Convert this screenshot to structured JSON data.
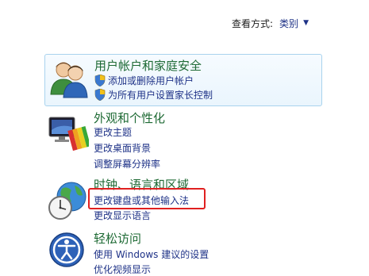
{
  "view": {
    "label": "查看方式:",
    "value": "类别"
  },
  "categories": [
    {
      "title": "用户帐户和家庭安全",
      "icon": "users-icon",
      "links": [
        "添加或删除用户帐户",
        "为所有用户设置家长控制"
      ]
    },
    {
      "title": "外观和个性化",
      "icon": "appearance-icon",
      "links": [
        "更改主题",
        "更改桌面背景",
        "调整屏幕分辨率"
      ]
    },
    {
      "title": "时钟、语言和区域",
      "icon": "clock-globe-icon",
      "links": [
        "更改键盘或其他输入法",
        "更改显示语言"
      ]
    },
    {
      "title": "轻松访问",
      "icon": "ease-of-access-icon",
      "links": [
        "使用 Windows 建议的设置",
        "优化视频显示"
      ]
    }
  ],
  "colors": {
    "title_green": "#1e6a34",
    "link_blue": "#1e3287",
    "highlight_border": "#a9d3ee",
    "annotation_red": "#e02020"
  }
}
